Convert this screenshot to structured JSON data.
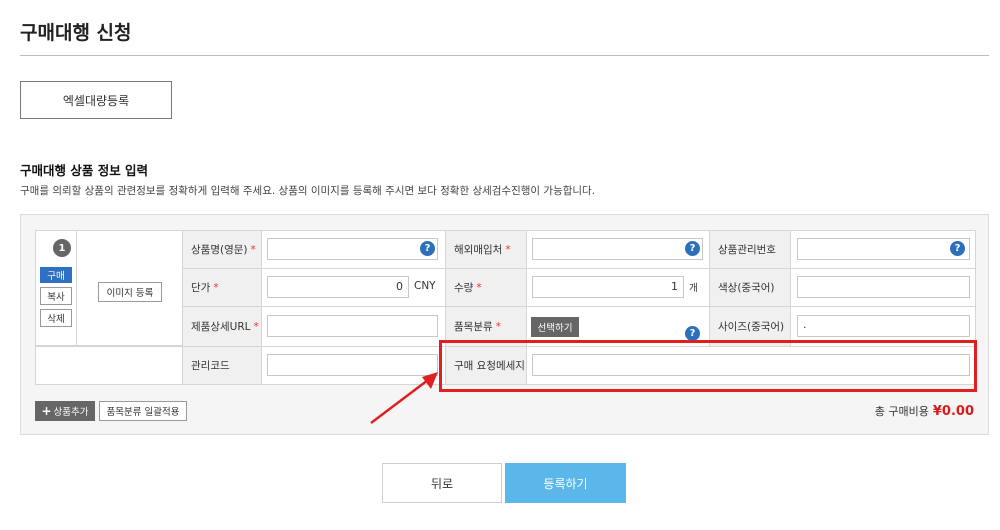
{
  "page": {
    "title": "구매대행 신청",
    "excel_button": "엑셀대량등록",
    "section_title": "구매대행 상품 정보 입력",
    "section_desc": "구매를 의뢰할 상품의 관련정보를 정확하게 입력해 주세요. 상품의 이미지를 등록해 주시면 보다 정확한 상세검수진행이 가능합니다."
  },
  "item": {
    "number": "1",
    "buy_label": "구매",
    "copy_label": "복사",
    "delete_label": "삭제",
    "image_button": "이미지 등록"
  },
  "form": {
    "product_name_label": "상품명(영문)",
    "overseas_shop_label": "해외매입처",
    "product_code_label": "상품관리번호",
    "unit_price_label": "단가",
    "unit_price_value": "0",
    "currency": "CNY",
    "quantity_label": "수량",
    "quantity_value": "1",
    "quantity_unit": "개",
    "color_label": "색상(중국어)",
    "url_label": "제품상세URL",
    "category_label": "품목분류",
    "category_button": "선택하기",
    "size_label": "사이즈(중국어)",
    "size_value": ".",
    "mgmt_code_label": "관리코드",
    "request_msg_label": "구매 요청메세지",
    "required_mark": "*",
    "help_mark": "?"
  },
  "footer": {
    "add_product": "상품추가",
    "add_icon": "+",
    "apply_category": "품목분류 일괄적용",
    "total_label": "총 구매비용",
    "total_value": "¥0.00",
    "back_button": "뒤로",
    "submit_button": "등록하기"
  },
  "colors": {
    "accent_blue": "#2f6fc4",
    "submit_blue": "#5bb7ea",
    "highlight_red": "#e02020",
    "total_red": "#d81c1c"
  }
}
